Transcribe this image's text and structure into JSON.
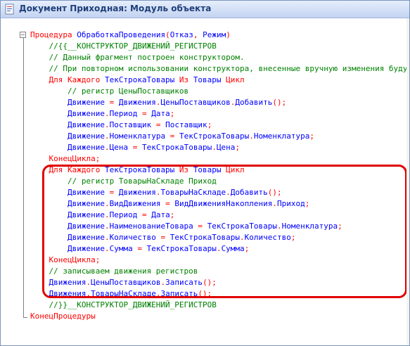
{
  "window": {
    "title": "Документ Приходная: Модуль объекта",
    "icon": "module-document-icon",
    "accent_color": "#1f3f7a"
  },
  "colors": {
    "keyword": "#ff0000",
    "identifier": "#0000ff",
    "comment": "#008000",
    "highlight_frame": "#e00000"
  },
  "code_lines": [
    [
      {
        "t": "kw",
        "s": "Процедура "
      },
      {
        "t": "id",
        "s": "ОбработкаПроведения"
      },
      {
        "t": "op",
        "s": "("
      },
      {
        "t": "id",
        "s": "Отказ"
      },
      {
        "t": "op",
        "s": ", "
      },
      {
        "t": "id",
        "s": "Режим"
      },
      {
        "t": "op",
        "s": ")"
      }
    ],
    [
      {
        "t": "cm",
        "s": "    //{{__КОНСТРУКТОР_ДВИЖЕНИЙ_РЕГИСТРОВ"
      }
    ],
    [
      {
        "t": "cm",
        "s": "    // Данный фрагмент построен конструктором."
      }
    ],
    [
      {
        "t": "cm",
        "s": "    // При повторном использовании конструктора, внесенные вручную изменения будут утеряны!!!"
      }
    ],
    [
      {
        "t": "kw",
        "s": "    Для Каждого "
      },
      {
        "t": "id",
        "s": "ТекСтрокаТовары"
      },
      {
        "t": "kw",
        "s": " Из "
      },
      {
        "t": "id",
        "s": "Товары"
      },
      {
        "t": "kw",
        "s": " Цикл"
      }
    ],
    [
      {
        "t": "cm",
        "s": "        // регистр ЦеныПоставщиков"
      }
    ],
    [
      {
        "t": "id",
        "s": "        Движение"
      },
      {
        "t": "op",
        "s": " = "
      },
      {
        "t": "id",
        "s": "Движения"
      },
      {
        "t": "op",
        "s": "."
      },
      {
        "t": "id",
        "s": "ЦеныПоставщиков"
      },
      {
        "t": "op",
        "s": "."
      },
      {
        "t": "id",
        "s": "Добавить"
      },
      {
        "t": "op",
        "s": "();"
      }
    ],
    [
      {
        "t": "id",
        "s": "        Движение"
      },
      {
        "t": "op",
        "s": "."
      },
      {
        "t": "id",
        "s": "Период"
      },
      {
        "t": "op",
        "s": " = "
      },
      {
        "t": "id",
        "s": "Дата"
      },
      {
        "t": "op",
        "s": ";"
      }
    ],
    [
      {
        "t": "id",
        "s": "        Движение"
      },
      {
        "t": "op",
        "s": "."
      },
      {
        "t": "id",
        "s": "Поставщик"
      },
      {
        "t": "op",
        "s": " = "
      },
      {
        "t": "id",
        "s": "Поставщик"
      },
      {
        "t": "op",
        "s": ";"
      }
    ],
    [
      {
        "t": "id",
        "s": "        Движение"
      },
      {
        "t": "op",
        "s": "."
      },
      {
        "t": "id",
        "s": "Номенклатура"
      },
      {
        "t": "op",
        "s": " = "
      },
      {
        "t": "id",
        "s": "ТекСтрокаТовары"
      },
      {
        "t": "op",
        "s": "."
      },
      {
        "t": "id",
        "s": "Номенклатура"
      },
      {
        "t": "op",
        "s": ";"
      }
    ],
    [
      {
        "t": "id",
        "s": "        Движение"
      },
      {
        "t": "op",
        "s": "."
      },
      {
        "t": "id",
        "s": "Цена"
      },
      {
        "t": "op",
        "s": " = "
      },
      {
        "t": "id",
        "s": "ТекСтрокаТовары"
      },
      {
        "t": "op",
        "s": "."
      },
      {
        "t": "id",
        "s": "Цена"
      },
      {
        "t": "op",
        "s": ";"
      }
    ],
    [
      {
        "t": "kw",
        "s": "    КонецЦикла"
      },
      {
        "t": "op",
        "s": ";"
      }
    ],
    [
      {
        "t": "kw",
        "s": "    Для Каждого "
      },
      {
        "t": "id",
        "s": "ТекСтрокаТовары"
      },
      {
        "t": "kw",
        "s": " Из "
      },
      {
        "t": "id",
        "s": "Товары"
      },
      {
        "t": "kw",
        "s": " Цикл"
      }
    ],
    [
      {
        "t": "cm",
        "s": "        // регистр ТоварыНаСкладе Приход"
      }
    ],
    [
      {
        "t": "id",
        "s": "        Движение"
      },
      {
        "t": "op",
        "s": " = "
      },
      {
        "t": "id",
        "s": "Движения"
      },
      {
        "t": "op",
        "s": "."
      },
      {
        "t": "id",
        "s": "ТоварыНаСкладе"
      },
      {
        "t": "op",
        "s": "."
      },
      {
        "t": "id",
        "s": "Добавить"
      },
      {
        "t": "op",
        "s": "();"
      }
    ],
    [
      {
        "t": "id",
        "s": "        Движение"
      },
      {
        "t": "op",
        "s": "."
      },
      {
        "t": "id",
        "s": "ВидДвижения"
      },
      {
        "t": "op",
        "s": " = "
      },
      {
        "t": "id",
        "s": "ВидДвиженияНакопления"
      },
      {
        "t": "op",
        "s": "."
      },
      {
        "t": "id",
        "s": "Приход"
      },
      {
        "t": "op",
        "s": ";"
      }
    ],
    [
      {
        "t": "id",
        "s": "        Движение"
      },
      {
        "t": "op",
        "s": "."
      },
      {
        "t": "id",
        "s": "Период"
      },
      {
        "t": "op",
        "s": " = "
      },
      {
        "t": "id",
        "s": "Дата"
      },
      {
        "t": "op",
        "s": ";"
      }
    ],
    [
      {
        "t": "id",
        "s": "        Движение"
      },
      {
        "t": "op",
        "s": "."
      },
      {
        "t": "id",
        "s": "НаименованиеТовара"
      },
      {
        "t": "op",
        "s": " = "
      },
      {
        "t": "id",
        "s": "ТекСтрокаТовары"
      },
      {
        "t": "op",
        "s": "."
      },
      {
        "t": "id",
        "s": "Номенклатура"
      },
      {
        "t": "op",
        "s": ";"
      }
    ],
    [
      {
        "t": "id",
        "s": "        Движение"
      },
      {
        "t": "op",
        "s": "."
      },
      {
        "t": "id",
        "s": "Количество"
      },
      {
        "t": "op",
        "s": " = "
      },
      {
        "t": "id",
        "s": "ТекСтрокаТовары"
      },
      {
        "t": "op",
        "s": "."
      },
      {
        "t": "id",
        "s": "Количество"
      },
      {
        "t": "op",
        "s": ";"
      }
    ],
    [
      {
        "t": "id",
        "s": "        Движение"
      },
      {
        "t": "op",
        "s": "."
      },
      {
        "t": "id",
        "s": "Сумма"
      },
      {
        "t": "op",
        "s": " = "
      },
      {
        "t": "id",
        "s": "ТекСтрокаТовары"
      },
      {
        "t": "op",
        "s": "."
      },
      {
        "t": "id",
        "s": "Сумма"
      },
      {
        "t": "op",
        "s": ";"
      }
    ],
    [
      {
        "t": "kw",
        "s": "    КонецЦикла"
      },
      {
        "t": "op",
        "s": ";"
      }
    ],
    [
      {
        "t": "cm",
        "s": "    // записываем движения регистров"
      }
    ],
    [
      {
        "t": "id",
        "s": "    Движения"
      },
      {
        "t": "op",
        "s": "."
      },
      {
        "t": "id",
        "s": "ЦеныПоставщиков"
      },
      {
        "t": "op",
        "s": "."
      },
      {
        "t": "id",
        "s": "Записать"
      },
      {
        "t": "op",
        "s": "();"
      }
    ],
    [
      {
        "t": "id",
        "s": "    Движения"
      },
      {
        "t": "op",
        "s": "."
      },
      {
        "t": "id",
        "s": "ТоварыНаСкладе"
      },
      {
        "t": "op",
        "s": "."
      },
      {
        "t": "id",
        "s": "Записать"
      },
      {
        "t": "op",
        "s": "();"
      }
    ],
    [
      {
        "t": "cm",
        "s": "    //}}__КОНСТРУКТОР_ДВИЖЕНИЙ_РЕГИСТРОВ"
      }
    ],
    [
      {
        "t": "kw",
        "s": "КонецПроцедуры"
      }
    ]
  ]
}
